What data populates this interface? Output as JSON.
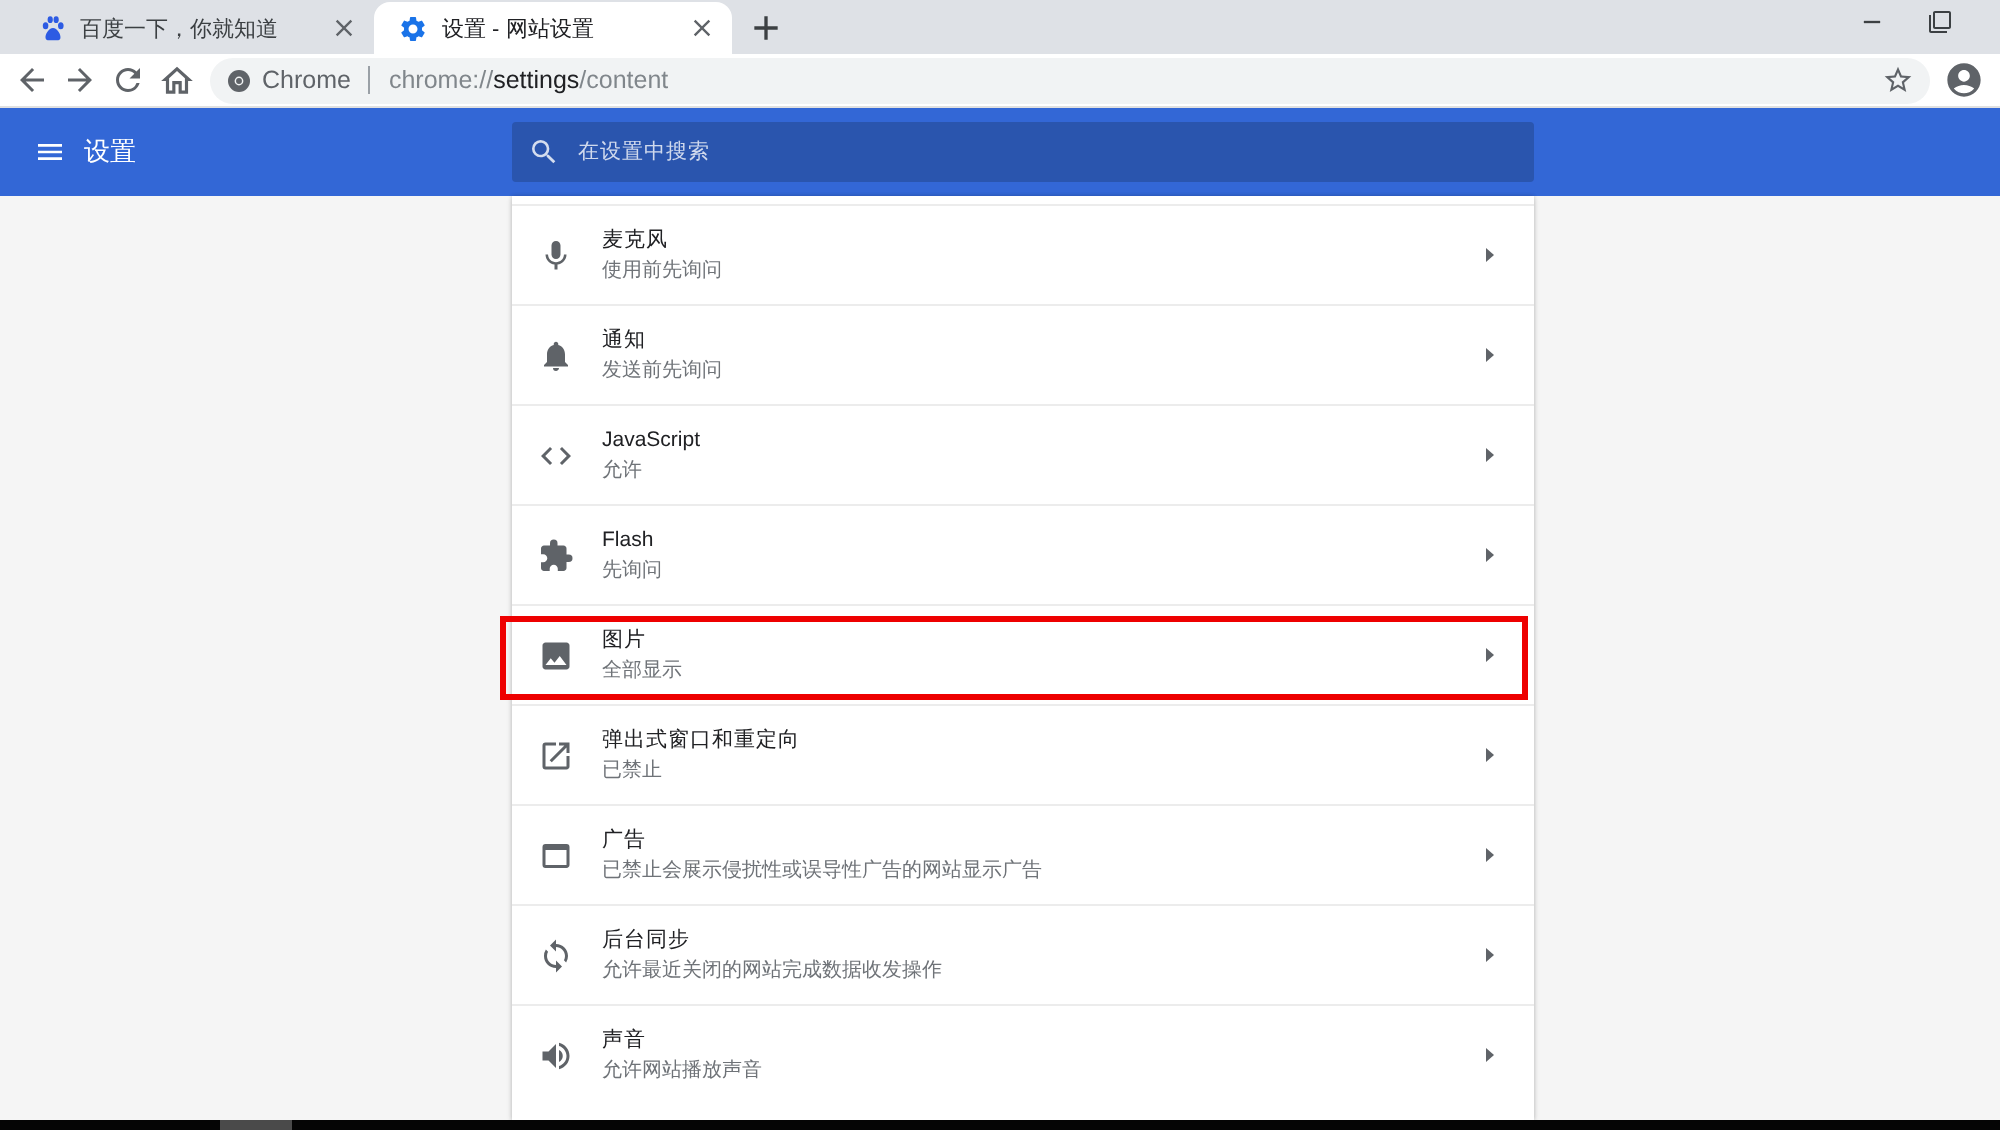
{
  "tabs": [
    {
      "title": "百度一下，你就知道",
      "selected": false
    },
    {
      "title": "设置 - 网站设置",
      "selected": true
    }
  ],
  "address_bar": {
    "chip": "Chrome",
    "url": {
      "scheme": "chrome://",
      "host": "settings",
      "path": "/content"
    }
  },
  "header": {
    "title": "设置",
    "search": {
      "placeholder": "在设置中搜索"
    }
  },
  "rows": [
    {
      "title": "麦克风",
      "subtitle": "使用前先询问",
      "highlighted": false
    },
    {
      "title": "通知",
      "subtitle": "发送前先询问",
      "highlighted": false
    },
    {
      "title": "JavaScript",
      "subtitle": "允许",
      "highlighted": false
    },
    {
      "title": "Flash",
      "subtitle": "先询问",
      "highlighted": false
    },
    {
      "title": "图片",
      "subtitle": "全部显示",
      "highlighted": true
    },
    {
      "title": "弹出式窗口和重定向",
      "subtitle": "已禁止",
      "highlighted": false
    },
    {
      "title": "广告",
      "subtitle": "已禁止会展示侵扰性或误导性广告的网站显示广告",
      "highlighted": false
    },
    {
      "title": "后台同步",
      "subtitle": "允许最近关闭的网站完成数据收发操作",
      "highlighted": false
    },
    {
      "title": "声音",
      "subtitle": "允许网站播放声音",
      "highlighted": false
    }
  ]
}
